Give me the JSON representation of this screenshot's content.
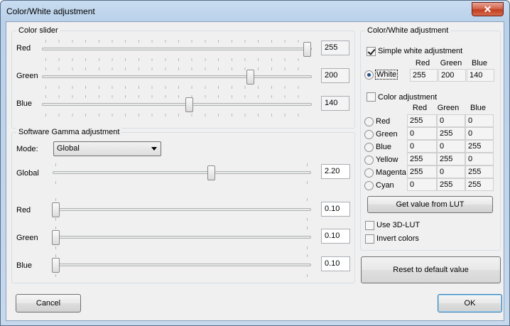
{
  "window": {
    "title": "Color/White adjustment",
    "close_glyph": "✕"
  },
  "color_slider": {
    "group_label": "Color slider",
    "rows": [
      {
        "label": "Red",
        "value": "255",
        "level": 1.0
      },
      {
        "label": "Green",
        "value": "200",
        "level": 0.784
      },
      {
        "label": "Blue",
        "value": "140",
        "level": 0.549
      }
    ]
  },
  "gamma": {
    "group_label": "Software Gamma adjustment",
    "mode_label": "Mode:",
    "mode_value": "Global",
    "rows": [
      {
        "label": "Global",
        "value": "2.20"
      },
      {
        "label": "Red",
        "value": "0.10"
      },
      {
        "label": "Green",
        "value": "0.10"
      },
      {
        "label": "Blue",
        "value": "0.10"
      }
    ]
  },
  "cw": {
    "group_label": "Color/White adjustment",
    "simple_white_label": "Simple white adjustment",
    "simple_white_checked": true,
    "headers": [
      "Red",
      "Green",
      "Blue"
    ],
    "white": {
      "label": "White",
      "values": [
        "255",
        "200",
        "140"
      ],
      "selected": true
    },
    "color_adj_label": "Color adjustment",
    "color_adj_checked": false,
    "colors": [
      {
        "label": "Red",
        "values": [
          "255",
          "0",
          "0"
        ]
      },
      {
        "label": "Green",
        "values": [
          "0",
          "255",
          "0"
        ]
      },
      {
        "label": "Blue",
        "values": [
          "0",
          "0",
          "255"
        ]
      },
      {
        "label": "Yellow",
        "values": [
          "255",
          "255",
          "0"
        ]
      },
      {
        "label": "Magenta",
        "values": [
          "255",
          "0",
          "255"
        ]
      },
      {
        "label": "Cyan",
        "values": [
          "0",
          "255",
          "255"
        ]
      }
    ],
    "lut_button": "Get value from LUT",
    "use_3dlut_label": "Use 3D-LUT",
    "invert_label": "Invert colors",
    "reset_button": "Reset to default value"
  },
  "footer": {
    "cancel": "Cancel",
    "ok": "OK"
  }
}
